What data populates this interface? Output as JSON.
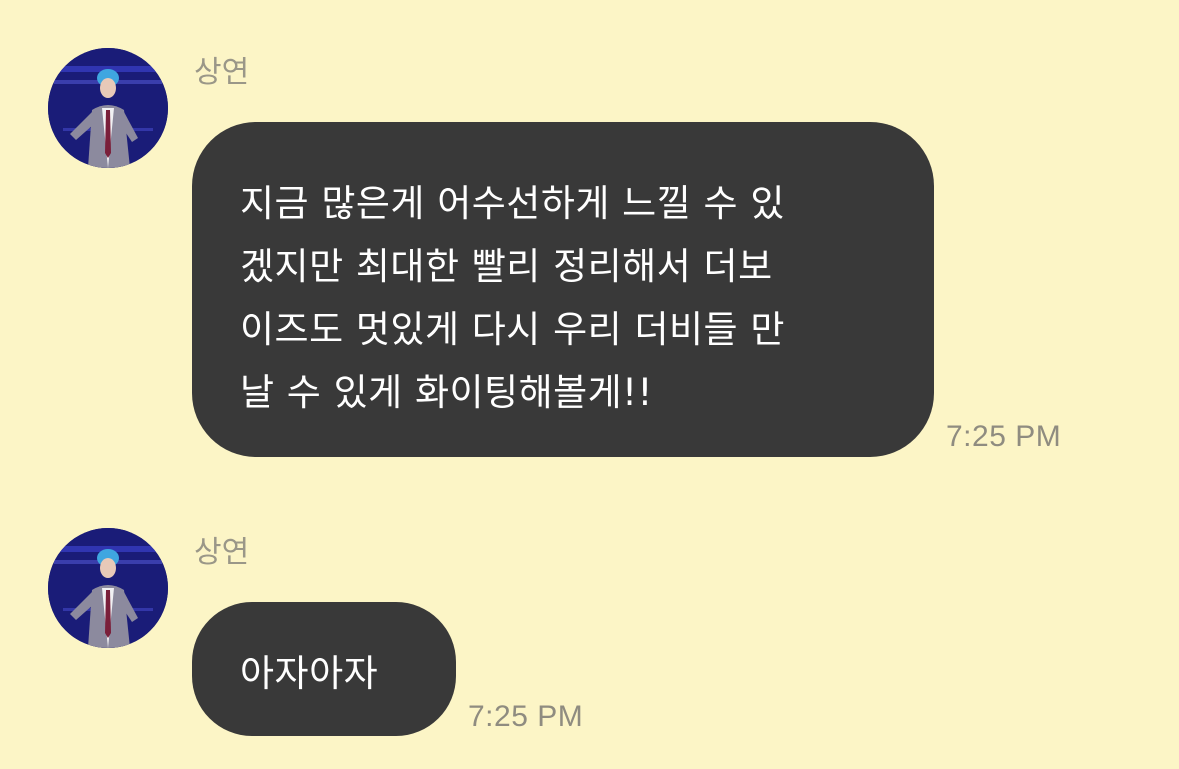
{
  "messages": [
    {
      "sender": "상연",
      "text": "지금 많은게 어수선하게 느낄 수 있\n겠지만 최대한 빨리 정리해서 더보\n이즈도 멋있게 다시 우리 더비들 만\n날 수 있게 화이팅해볼게!!",
      "time": "7:25 PM"
    },
    {
      "sender": "상연",
      "text": "아자아자",
      "time": "7:25 PM"
    }
  ],
  "colors": {
    "background": "#fcf5c6",
    "bubble": "#393939",
    "bubble_text": "#ffffff",
    "meta_text": "#9a9788"
  }
}
